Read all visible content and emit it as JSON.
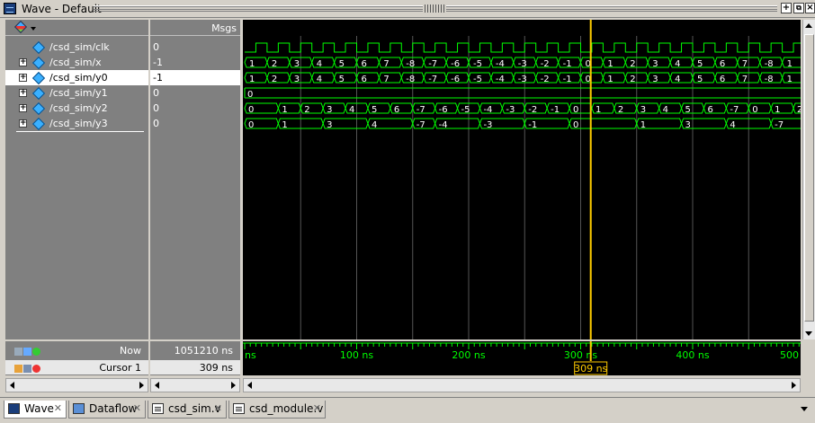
{
  "window": {
    "title": "Wave - Default"
  },
  "header": {
    "msgs_label": "Msgs"
  },
  "signals": [
    {
      "name": "/csd_sim/clk",
      "value": "0",
      "expandable": false,
      "selected": false
    },
    {
      "name": "/csd_sim/x",
      "value": "-1",
      "expandable": true,
      "selected": false
    },
    {
      "name": "/csd_sim/y0",
      "value": "-1",
      "expandable": true,
      "selected": true
    },
    {
      "name": "/csd_sim/y1",
      "value": "0",
      "expandable": true,
      "selected": false
    },
    {
      "name": "/csd_sim/y2",
      "value": "0",
      "expandable": true,
      "selected": false
    },
    {
      "name": "/csd_sim/y3",
      "value": "0",
      "expandable": true,
      "selected": false
    }
  ],
  "info": {
    "now_label": "Now",
    "now_value": "1051210 ns",
    "cursor_label": "Cursor 1",
    "cursor_value": "309 ns",
    "cursor_marker": "309 ns"
  },
  "time_axis": {
    "labels": [
      "ns",
      "100 ns",
      "200 ns",
      "300 ns",
      "400 ns",
      "500"
    ]
  },
  "waves": {
    "x": [
      "1",
      "2",
      "3",
      "4",
      "5",
      "6",
      "7",
      "-8",
      "-7",
      "-6",
      "-5",
      "-4",
      "-3",
      "-2",
      "-1",
      "0",
      "1",
      "2",
      "3",
      "4",
      "5",
      "6",
      "7",
      "-8"
    ],
    "y0": [
      "1",
      "2",
      "3",
      "4",
      "5",
      "6",
      "7",
      "-8",
      "-7",
      "-6",
      "-5",
      "-4",
      "-3",
      "-2",
      "-1",
      "0",
      "1",
      "2",
      "3",
      "4",
      "5",
      "6",
      "7",
      "-8"
    ],
    "y1": [
      "0"
    ],
    "y2": [
      "0",
      "1",
      "2",
      "3",
      "4",
      "5",
      "6",
      "-7",
      "-6",
      "-5",
      "-4",
      "-3",
      "-2",
      "-1",
      "0",
      "1",
      "2",
      "3",
      "4",
      "5",
      "6",
      "-7"
    ],
    "y3": [
      "0",
      "1",
      "3",
      "4",
      "-7",
      "-4",
      "-3",
      "-1",
      "0",
      "1",
      "3",
      "4",
      "-7"
    ]
  },
  "tabs": [
    {
      "label": "Wave",
      "active": true,
      "icon": "wave-icon"
    },
    {
      "label": "Dataflow",
      "active": false,
      "icon": "dataflow-icon"
    },
    {
      "label": "csd_sim.v",
      "active": false,
      "icon": "file-icon"
    },
    {
      "label": "csd_module.v",
      "active": false,
      "icon": "file-icon"
    }
  ],
  "colors": {
    "wave": "#00ff00",
    "cursor": "#ffcc00",
    "grid": "#555555",
    "axis_text": "#00ff00"
  }
}
